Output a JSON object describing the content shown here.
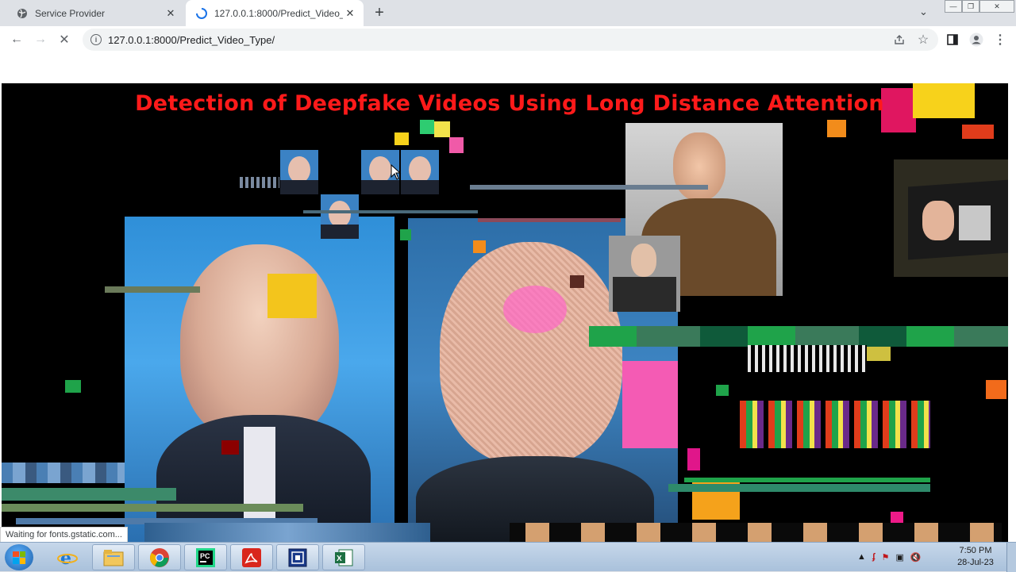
{
  "tabs": [
    {
      "title": "Service Provider",
      "active": false
    },
    {
      "title": "127.0.0.1:8000/Predict_Video_Typ",
      "active": true
    }
  ],
  "toolbar": {
    "url": "127.0.0.1:8000/Predict_Video_Type/"
  },
  "page": {
    "hero_title": "Detection of Deepfake Videos Using Long Distance Attention"
  },
  "status": {
    "text": "Waiting for fonts.gstatic.com..."
  },
  "taskbar": {
    "apps": [
      "internet-explorer",
      "file-explorer",
      "chrome",
      "pycharm",
      "acrobat-reader",
      "remote-app",
      "excel"
    ],
    "clock_time": "7:50 PM",
    "clock_date": "28-Jul-23"
  },
  "colors": {
    "title_red": "#ff1a1a",
    "hero_bg": "#000000",
    "taskbar_top": "#c6d7ea"
  }
}
